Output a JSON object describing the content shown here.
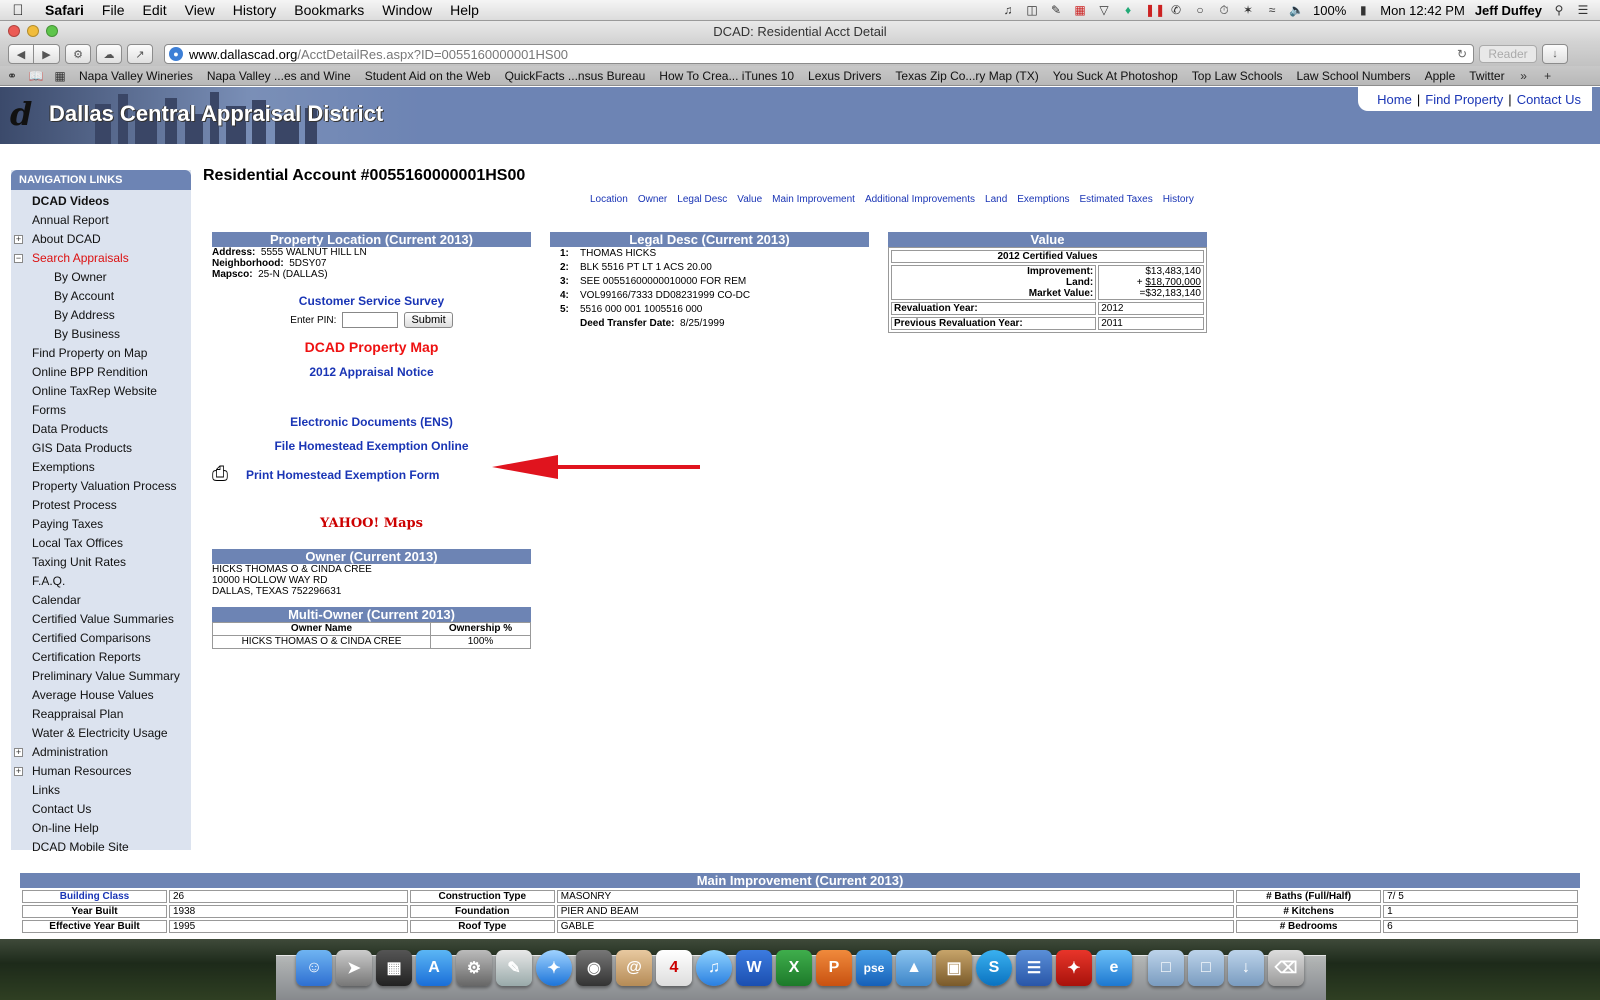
{
  "menubar": {
    "app": "Safari",
    "items": [
      "File",
      "Edit",
      "View",
      "History",
      "Bookmarks",
      "Window",
      "Help"
    ],
    "battery": "100%",
    "clock": "Mon 12:42 PM",
    "user": "Jeff Duffey"
  },
  "window": {
    "title": "DCAD: Residential Acct Detail",
    "url_host": "www.dallascad.org",
    "url_path": "/AcctDetailRes.aspx?ID=0055160000001HS00",
    "reader_label": "Reader"
  },
  "bookmarks": [
    "Napa Valley Wineries",
    "Napa Valley ...es and Wine",
    "Student Aid on the Web",
    "QuickFacts ...nsus Bureau",
    "How To Crea... iTunes 10",
    "Lexus Drivers",
    "Texas Zip Co...ry Map (TX)",
    "You Suck At Photoshop",
    "Top Law Schools",
    "Law School Numbers",
    "Apple",
    "Twitter"
  ],
  "site": {
    "name": "Dallas Central Appraisal District",
    "top_links": [
      "Home",
      "Find Property",
      "Contact Us"
    ]
  },
  "sidebar": {
    "heading": "NAVIGATION LINKS",
    "items": [
      {
        "label": "DCAD Videos"
      },
      {
        "label": "Annual Report"
      },
      {
        "label": "About DCAD"
      },
      {
        "label": "Search Appraisals"
      },
      {
        "label": "By Owner"
      },
      {
        "label": "By Account"
      },
      {
        "label": "By Address"
      },
      {
        "label": "By Business"
      },
      {
        "label": "Find Property on Map"
      },
      {
        "label": "Online BPP Rendition"
      },
      {
        "label": "Online TaxRep Website"
      },
      {
        "label": "Forms"
      },
      {
        "label": "Data Products"
      },
      {
        "label": "GIS Data Products"
      },
      {
        "label": "Exemptions"
      },
      {
        "label": "Property Valuation Process"
      },
      {
        "label": "Protest Process"
      },
      {
        "label": "Paying Taxes"
      },
      {
        "label": "Local Tax Offices"
      },
      {
        "label": "Taxing Unit Rates"
      },
      {
        "label": "F.A.Q."
      },
      {
        "label": "Calendar"
      },
      {
        "label": "Certified Value Summaries"
      },
      {
        "label": "Certified Comparisons"
      },
      {
        "label": "Certification Reports"
      },
      {
        "label": "Preliminary Value Summary"
      },
      {
        "label": "Average House Values"
      },
      {
        "label": "Reappraisal Plan"
      },
      {
        "label": "Water & Electricity Usage"
      },
      {
        "label": "Administration"
      },
      {
        "label": "Human Resources"
      },
      {
        "label": "Links"
      },
      {
        "label": "Contact Us"
      },
      {
        "label": "On-line Help"
      },
      {
        "label": "DCAD Mobile Site"
      }
    ]
  },
  "account": {
    "title": "Residential Account #0055160000001HS00",
    "anchors": [
      "Location",
      "Owner",
      "Legal Desc",
      "Value",
      "Main Improvement",
      "Additional Improvements",
      "Land",
      "Exemptions",
      "Estimated Taxes",
      "History"
    ]
  },
  "location": {
    "heading": "Property Location (Current 2013)",
    "address_label": "Address:",
    "address": "5555  WALNUT HILL LN",
    "neighborhood_label": "Neighborhood:",
    "neighborhood": "5DSY07",
    "mapsco_label": "Mapsco:",
    "mapsco": "25-N (DALLAS)",
    "survey": "Customer Service Survey",
    "pin_label": "Enter PIN:",
    "submit": "Submit",
    "property_map": "DCAD Property Map",
    "appraisal_notice": "2012 Appraisal Notice",
    "ens": "Electronic Documents (ENS)",
    "homestead_online": "File Homestead Exemption Online",
    "homestead_print": "Print Homestead Exemption Form",
    "yahoo": "YAHOO! Maps"
  },
  "legal": {
    "heading": "Legal Desc (Current 2013)",
    "lines": [
      {
        "n": "1:",
        "text": "THOMAS HICKS"
      },
      {
        "n": "2:",
        "text": "BLK 5516 PT LT 1 ACS 20.00"
      },
      {
        "n": "3:",
        "text": "SEE 00551600000010000 FOR REM"
      },
      {
        "n": "4:",
        "text": "VOL99166/7333 DD08231999 CO-DC"
      },
      {
        "n": "5:",
        "text": "5516 000 001 1005516 000"
      }
    ],
    "deed_label": "Deed Transfer Date:",
    "deed_date": "8/25/1999"
  },
  "value": {
    "heading": "Value",
    "certified": "2012 Certified Values",
    "improvement_label": "Improvement:",
    "improvement": "$13,483,140",
    "land_label": "Land:",
    "land_prefix": "+",
    "land": "$18,700,000",
    "market_label": "Market Value:",
    "market": "=$32,183,140",
    "reval_label": "Revaluation Year:",
    "reval": "2012",
    "prev_label": "Previous Revaluation Year:",
    "prev": "2011"
  },
  "owner": {
    "heading": "Owner (Current 2013)",
    "line1": "HICKS THOMAS O & CINDA CREE",
    "line2": "10000 HOLLOW WAY RD",
    "line3": "DALLAS, TEXAS 752296631"
  },
  "multi_owner": {
    "heading": "Multi-Owner (Current 2013)",
    "col1": "Owner Name",
    "col2": "Ownership %",
    "name": "HICKS THOMAS O & CINDA CREE",
    "pct": "100%"
  },
  "improvement": {
    "heading": "Main Improvement (Current 2013)",
    "rows": [
      [
        "Building Class",
        "26",
        "Construction Type",
        "MASONRY",
        "# Baths (Full/Half)",
        "7/ 5"
      ],
      [
        "Year Built",
        "1938",
        "Foundation",
        "PIER AND BEAM",
        "# Kitchens",
        "1"
      ],
      [
        "Effective Year Built",
        "1995",
        "Roof Type",
        "GABLE",
        "# Bedrooms",
        "6"
      ]
    ]
  },
  "colors": {
    "brand": "#6d84b4",
    "link": "#1a35b5",
    "alert": "#e11111"
  }
}
